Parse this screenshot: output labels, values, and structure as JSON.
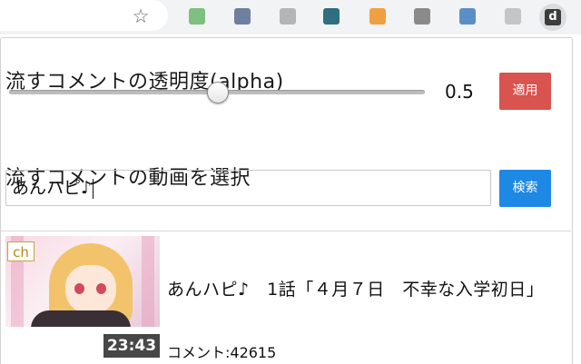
{
  "toolbar": {
    "star_glyph": "☆",
    "extensions": [
      {
        "name": "ext-green",
        "color": "#7fbf7f"
      },
      {
        "name": "ext-gear",
        "color": "#6f7f9f"
      },
      {
        "name": "ext-gray",
        "color": "#b5b5b5"
      },
      {
        "name": "ext-teal",
        "color": "#2f6f7f"
      },
      {
        "name": "ext-orange",
        "color": "#f0a040"
      },
      {
        "name": "ext-dark",
        "color": "#8a8a8a"
      },
      {
        "name": "ext-blue",
        "color": "#5a8fc5"
      },
      {
        "name": "ext-light",
        "color": "#c5c5c5"
      }
    ],
    "active_extension_label": "d"
  },
  "opacity": {
    "heading": "流すコメントの透明度(alpha)",
    "value": 0.5,
    "value_label": "0.5",
    "apply_label": "適用"
  },
  "video_select": {
    "heading": "流すコメントの動画を選択",
    "query": "あんハピ♪",
    "search_label": "検索"
  },
  "results": [
    {
      "badge": "ch",
      "duration": "23:43",
      "title": "あんハピ♪　1話「４月７日　不幸な入学初日」",
      "comments": "コメント:42615"
    }
  ],
  "colors": {
    "apply_button": "#d9534f",
    "search_button": "#1e88e5"
  }
}
